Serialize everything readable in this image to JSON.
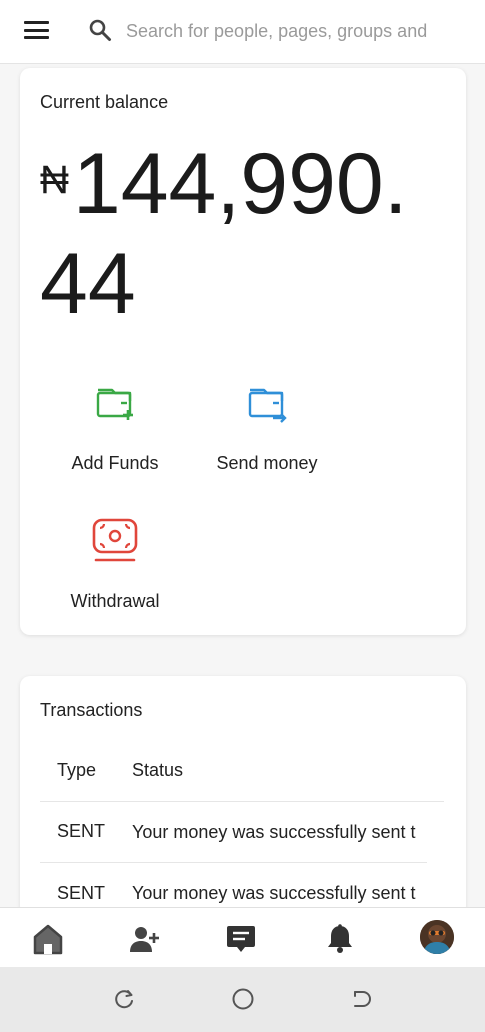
{
  "topbar": {
    "menu_icon": "hamburger-menu-icon",
    "search_icon": "search-icon",
    "search_placeholder": "Search for people, pages, groups and"
  },
  "balance": {
    "title": "Current balance",
    "currency_symbol": "₦",
    "amount": "144,990.44"
  },
  "actions": [
    {
      "label": "Add Funds",
      "icon": "wallet-add-icon",
      "color": "#3aa845"
    },
    {
      "label": "Send money",
      "icon": "wallet-send-icon",
      "color": "#2f8fd8"
    },
    {
      "label": "Withdrawal",
      "icon": "cash-withdraw-icon",
      "color": "#e0463b"
    }
  ],
  "transactions": {
    "title": "Transactions",
    "headers": {
      "type": "Type",
      "status": "Status"
    },
    "rows": [
      {
        "type": "SENT",
        "status": "Your money was successfully sent t"
      },
      {
        "type": "SENT",
        "status": "Your money was successfully sent t"
      }
    ]
  },
  "bottom_nav": [
    {
      "name": "home",
      "icon": "home-icon"
    },
    {
      "name": "friends",
      "icon": "add-friend-icon"
    },
    {
      "name": "messages",
      "icon": "message-icon"
    },
    {
      "name": "notifications",
      "icon": "bell-icon"
    },
    {
      "name": "profile",
      "icon": "avatar"
    }
  ],
  "system_nav": [
    {
      "name": "recent-apps",
      "icon": "recent-apps-icon"
    },
    {
      "name": "home",
      "icon": "system-home-icon"
    },
    {
      "name": "back",
      "icon": "back-icon"
    }
  ],
  "colors": {
    "add_green": "#3aa845",
    "send_blue": "#2f8fd8",
    "withdraw_red": "#e0463b",
    "nav_icon": "#333333"
  }
}
